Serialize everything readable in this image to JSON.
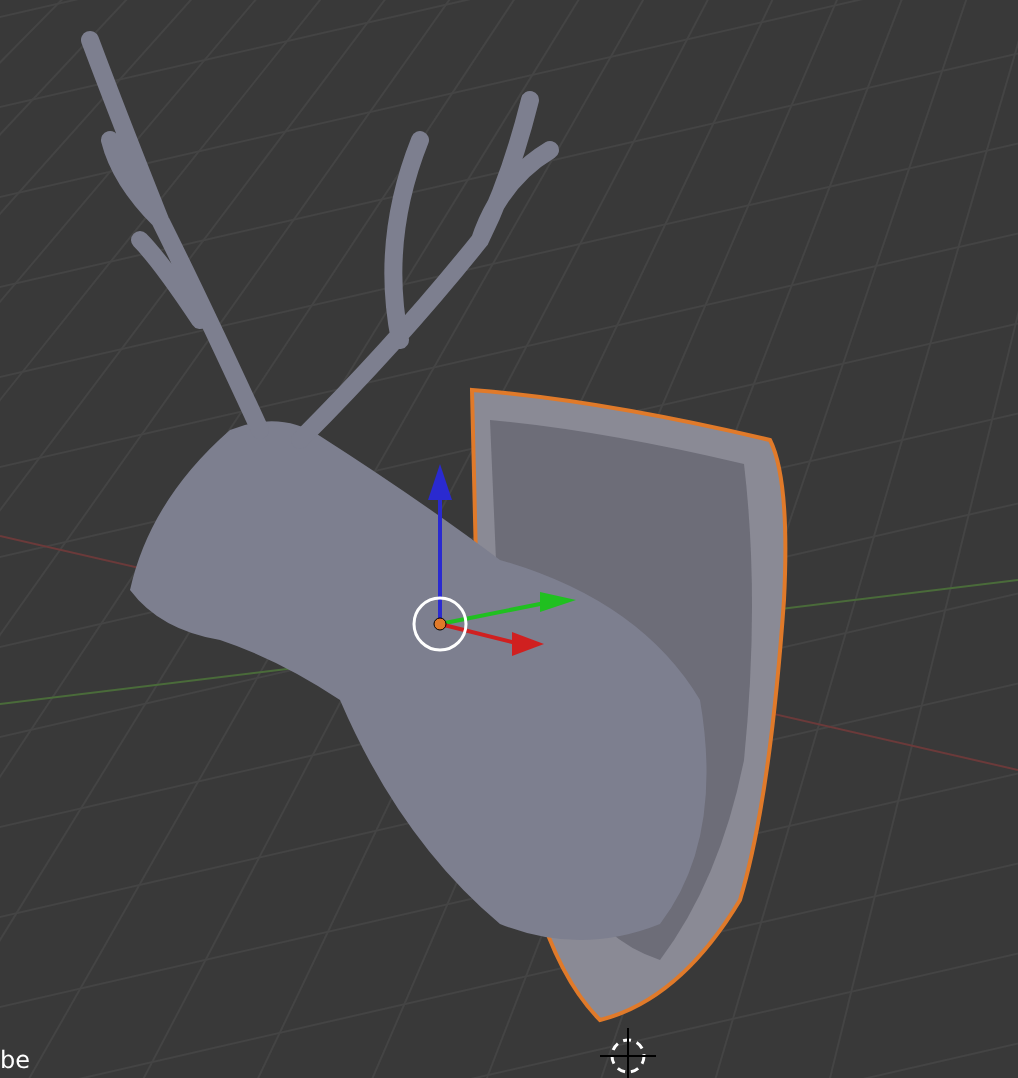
{
  "viewport": {
    "object_label": "be"
  }
}
